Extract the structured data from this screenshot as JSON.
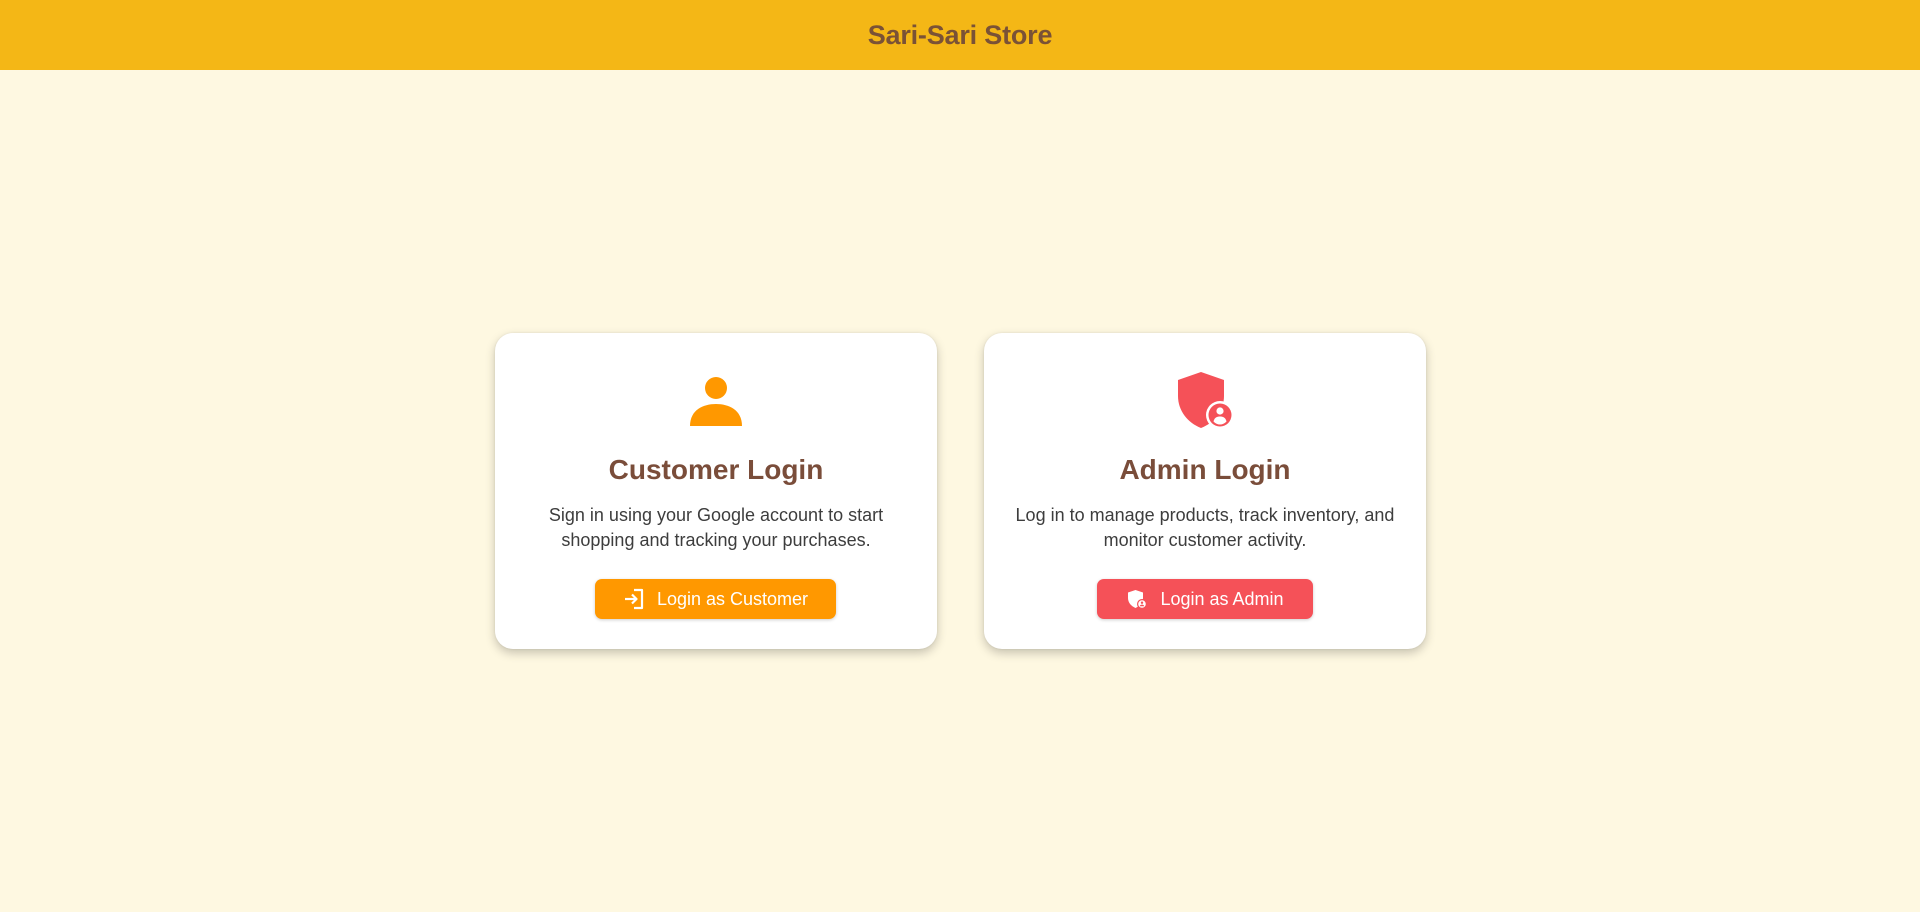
{
  "header": {
    "title": "Sari-Sari Store",
    "background_color": "#f4b716",
    "title_color": "#7a5236"
  },
  "page": {
    "background_color": "#fef8e1"
  },
  "cards": [
    {
      "icon": "person-icon",
      "icon_color": "#ff9800",
      "title": "Customer Login",
      "description": "Sign in using your Google account to start shopping and tracking your purchases.",
      "button_label": "Login as Customer",
      "button_icon": "login-icon",
      "button_color": "#ff9800"
    },
    {
      "icon": "admin-shield-icon",
      "icon_color": "#f55158",
      "title": "Admin Login",
      "description": "Log in to manage products, track inventory, and monitor customer activity.",
      "button_label": "Login as Admin",
      "button_icon": "admin-shield-icon",
      "button_color": "#f55158"
    }
  ]
}
